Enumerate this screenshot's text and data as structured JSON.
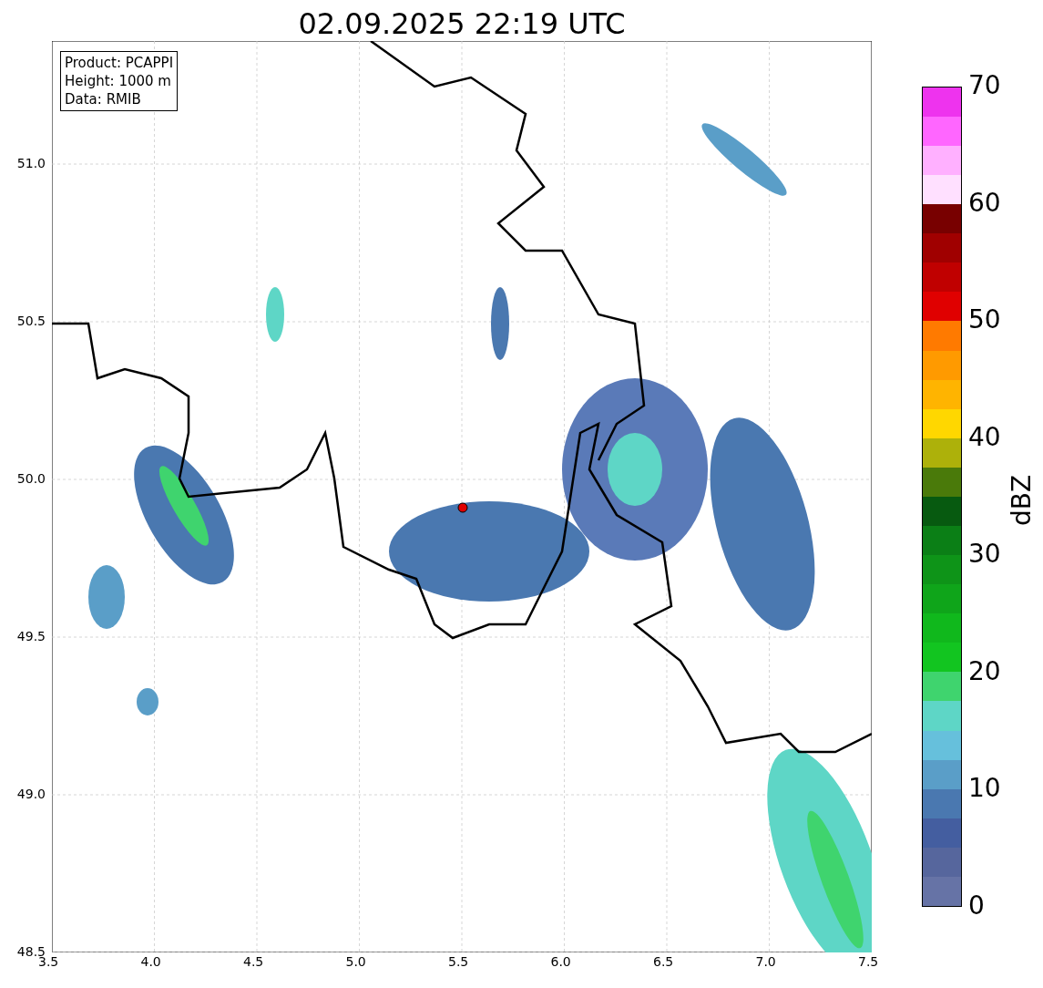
{
  "title": "02.09.2025 22:19 UTC",
  "info_box": [
    "Product: PCAPPI",
    "Height: 1000 m",
    "Data: RMIB"
  ],
  "x_ticks": [
    "3.5",
    "4.0",
    "4.5",
    "5.0",
    "5.5",
    "6.0",
    "6.5",
    "7.0",
    "7.5"
  ],
  "y_ticks": [
    "51.0",
    "50.5",
    "50.0",
    "49.5",
    "49.0",
    "48.5"
  ],
  "colorbar": {
    "label": "dBZ",
    "ticks": [
      "70",
      "60",
      "50",
      "40",
      "30",
      "20",
      "10",
      "0"
    ]
  }
}
